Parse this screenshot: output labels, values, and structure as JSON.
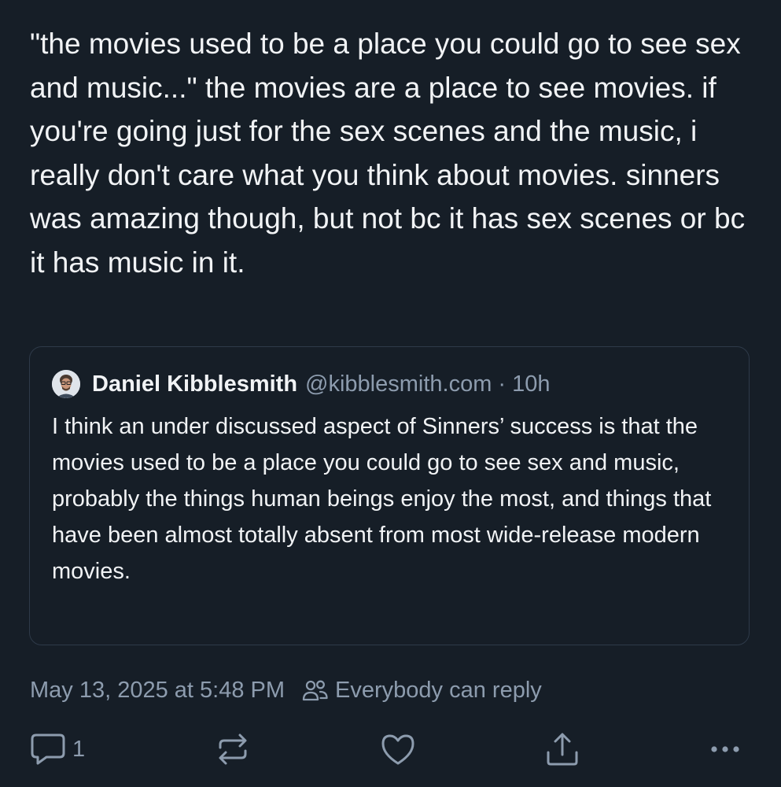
{
  "post": {
    "text": "\"the movies used to be a place you could go to see sex and music...\" the movies are a place to see movies. if you're going just for the sex scenes and the music, i really don't care what you think about movies. sinners was amazing though, but not bc it has sex scenes or bc it has music in it.",
    "timestamp": "May 13, 2025 at 5:48 PM",
    "reply_setting": "Everybody can reply"
  },
  "quote": {
    "author_name": "Daniel Kibblesmith",
    "author_handle": "@kibblesmith.com",
    "separator": "·",
    "age": "10h",
    "text": "I think an under discussed aspect of Sinners’ success is that the movies used to be a place you could go to see sex and music, probably the things human beings enjoy the most, and things that have been almost totally absent from most wide-release modern movies."
  },
  "actions": {
    "reply_count": "1",
    "icons": [
      "reply-icon",
      "repost-icon",
      "like-icon",
      "share-icon",
      "more-icon"
    ]
  },
  "colors": {
    "background": "#161e27",
    "text": "#f1f3f5",
    "muted": "#8d9cae",
    "border": "#2e3a49"
  }
}
